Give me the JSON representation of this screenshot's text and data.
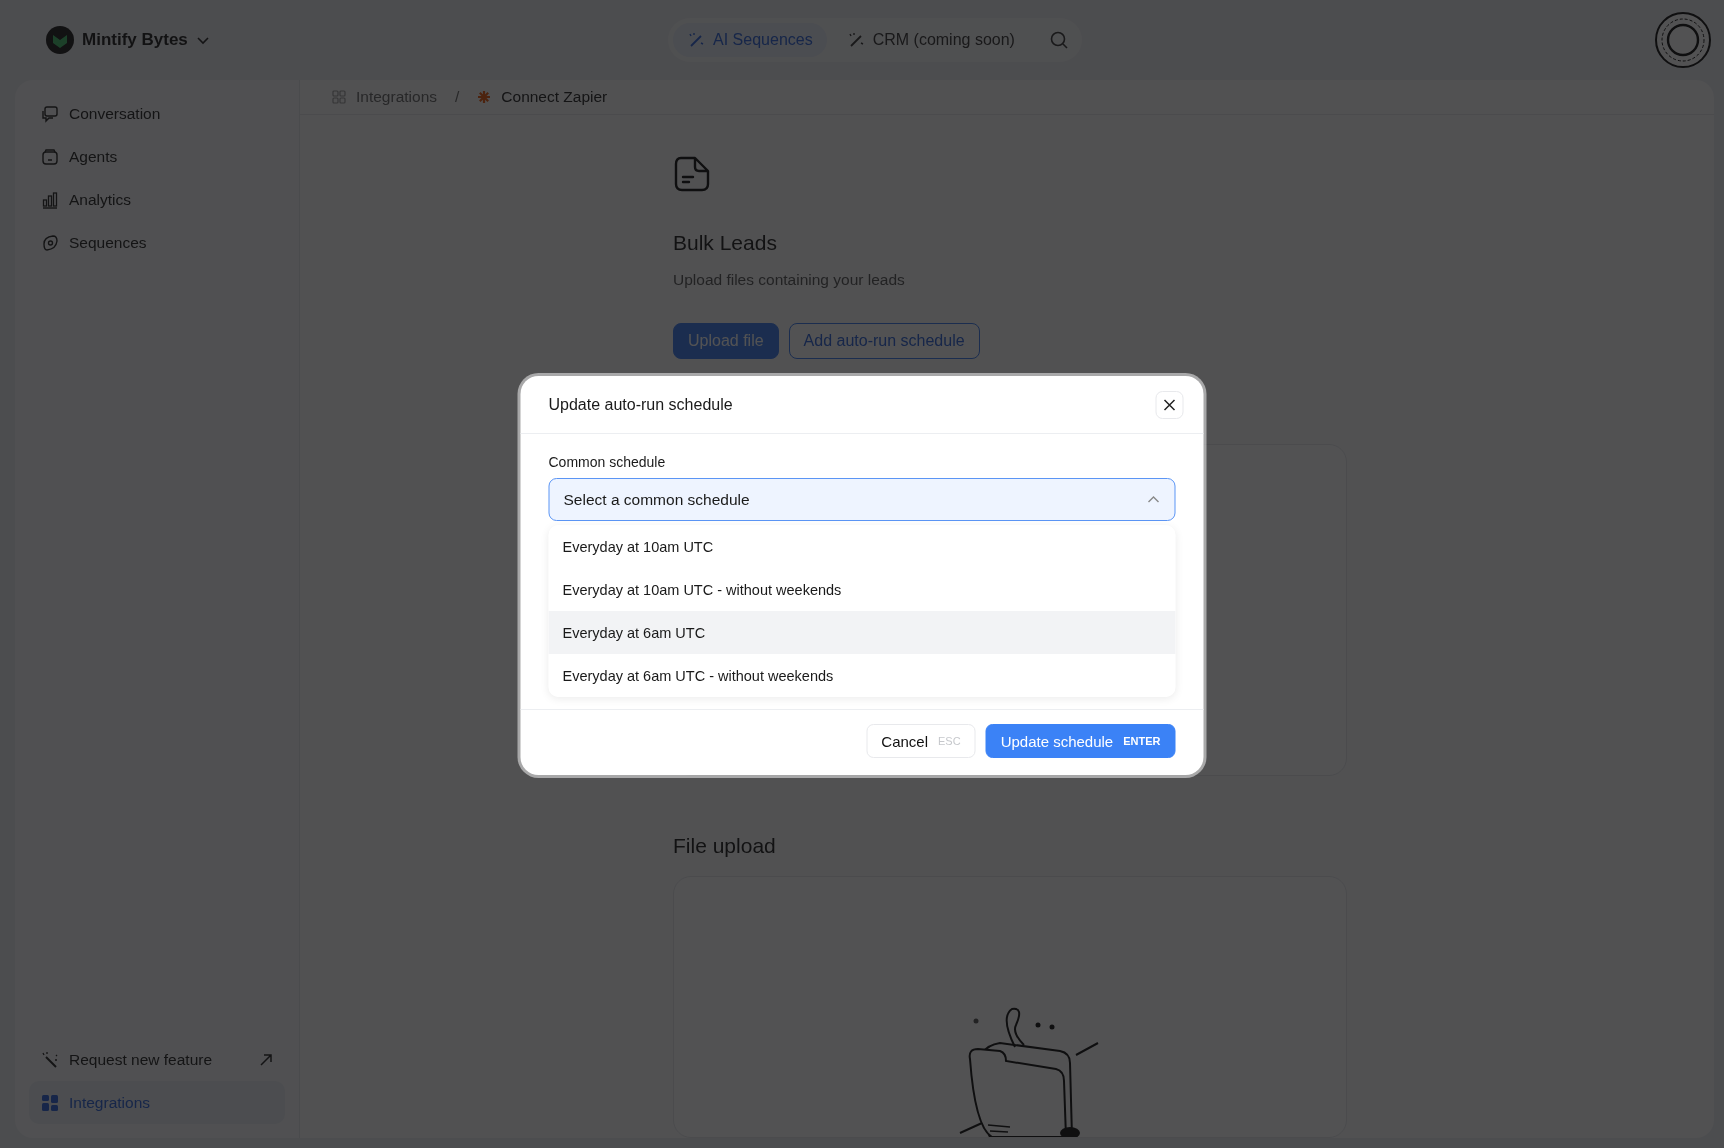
{
  "header": {
    "workspace": "Mintify Bytes",
    "tabs": [
      {
        "label": "AI Sequences",
        "selected": true
      },
      {
        "label": "CRM (coming soon)",
        "selected": false
      }
    ]
  },
  "sidebar": {
    "items": [
      {
        "label": "Conversation",
        "selected": false
      },
      {
        "label": "Agents",
        "selected": false
      },
      {
        "label": "Analytics",
        "selected": false
      },
      {
        "label": "Sequences",
        "selected": false
      }
    ],
    "footer_items": [
      {
        "label": "Request new feature",
        "selected": false
      },
      {
        "label": "Integrations",
        "selected": true
      }
    ]
  },
  "breadcrumb": {
    "items": [
      "Integrations",
      "Connect Zapier"
    ],
    "separator": "/"
  },
  "bulk_leads": {
    "title": "Bulk Leads",
    "subtitle": "Upload files containing your leads",
    "buttons": [
      "Upload file",
      "Add auto-run schedule"
    ]
  },
  "file_upload": {
    "title": "File upload"
  },
  "dialog": {
    "title": "Update auto-run schedule",
    "field_label": "Common schedule",
    "placeholder": "Select a common schedule",
    "expanded": true,
    "options": [
      {
        "label": "Everyday at 10am UTC",
        "highlighted": false
      },
      {
        "label": "Everyday at 10am UTC - without weekends",
        "highlighted": false
      },
      {
        "label": "Everyday at 6am UTC",
        "highlighted": true
      },
      {
        "label": "Everyday at 6am UTC - without weekends",
        "highlighted": false
      }
    ],
    "cancel": {
      "label": "Cancel",
      "shortcut": "ESC"
    },
    "confirm": {
      "label": "Update schedule",
      "shortcut": "ENTER"
    }
  }
}
